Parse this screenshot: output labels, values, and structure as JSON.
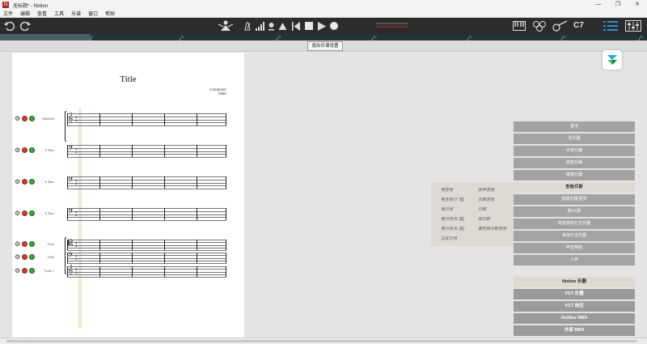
{
  "window": {
    "title": "无标题* - Notion",
    "icon_glyph": "N",
    "minimize": "—",
    "maximize": "❐",
    "close": "✕"
  },
  "menu": [
    "文件",
    "编辑",
    "查看",
    "工具",
    "乐谱",
    "窗口",
    "帮助"
  ],
  "toolbar": {
    "icons": [
      "undo-icon",
      "redo-icon",
      "conductor-icon",
      "metronome-icon",
      "volume-icon",
      "tuner-icon",
      "warning-icon",
      "rewind-icon",
      "stop-icon",
      "play-icon",
      "record-icon",
      "keyboard-icon",
      "drumpad-icon",
      "guitar-icon",
      "menu-icon",
      "mixer-icon"
    ],
    "position_label": "C7",
    "accent": "#25b4ff"
  },
  "ruler": {
    "ticks": [
      "5",
      "10",
      "15",
      "20",
      "25",
      "30",
      "35"
    ],
    "progress": 0.14
  },
  "exit_button": "退出乐谱设置",
  "score": {
    "title": "Title",
    "composer": "Composer",
    "date": "Date",
    "instruments": [
      "Mandolin",
      "E. Bass",
      "E. Bass",
      "E. Bass",
      "Viola",
      "Cello",
      "Violin 1"
    ]
  },
  "library": {
    "categories": [
      "基本",
      "弦乐器",
      "木管乐器",
      "铜管乐器",
      "键盘乐器",
      "吉他/贝斯",
      "弹拨乐器/竖琴",
      "鼓/大鼓",
      "有音高的打击乐器",
      "其他打击乐器",
      "声音特效",
      "人声"
    ],
    "selected_index": 5,
    "sub_items_left": [
      "电吉他",
      "电吉他 (7 弦)",
      "电贝司",
      "电贝司 (5 弦)",
      "电贝司 (6 弦)",
      "立式贝司"
    ],
    "sub_items_right": [
      "原声吉他",
      "古典吉他",
      "贝斯",
      "低贝斯",
      "曼陀林贝斯吉他"
    ],
    "external": [
      "Notion 乐器",
      "VST 乐器",
      "VST 效应",
      "ReWire MIDI",
      "外部 MIDI"
    ]
  }
}
